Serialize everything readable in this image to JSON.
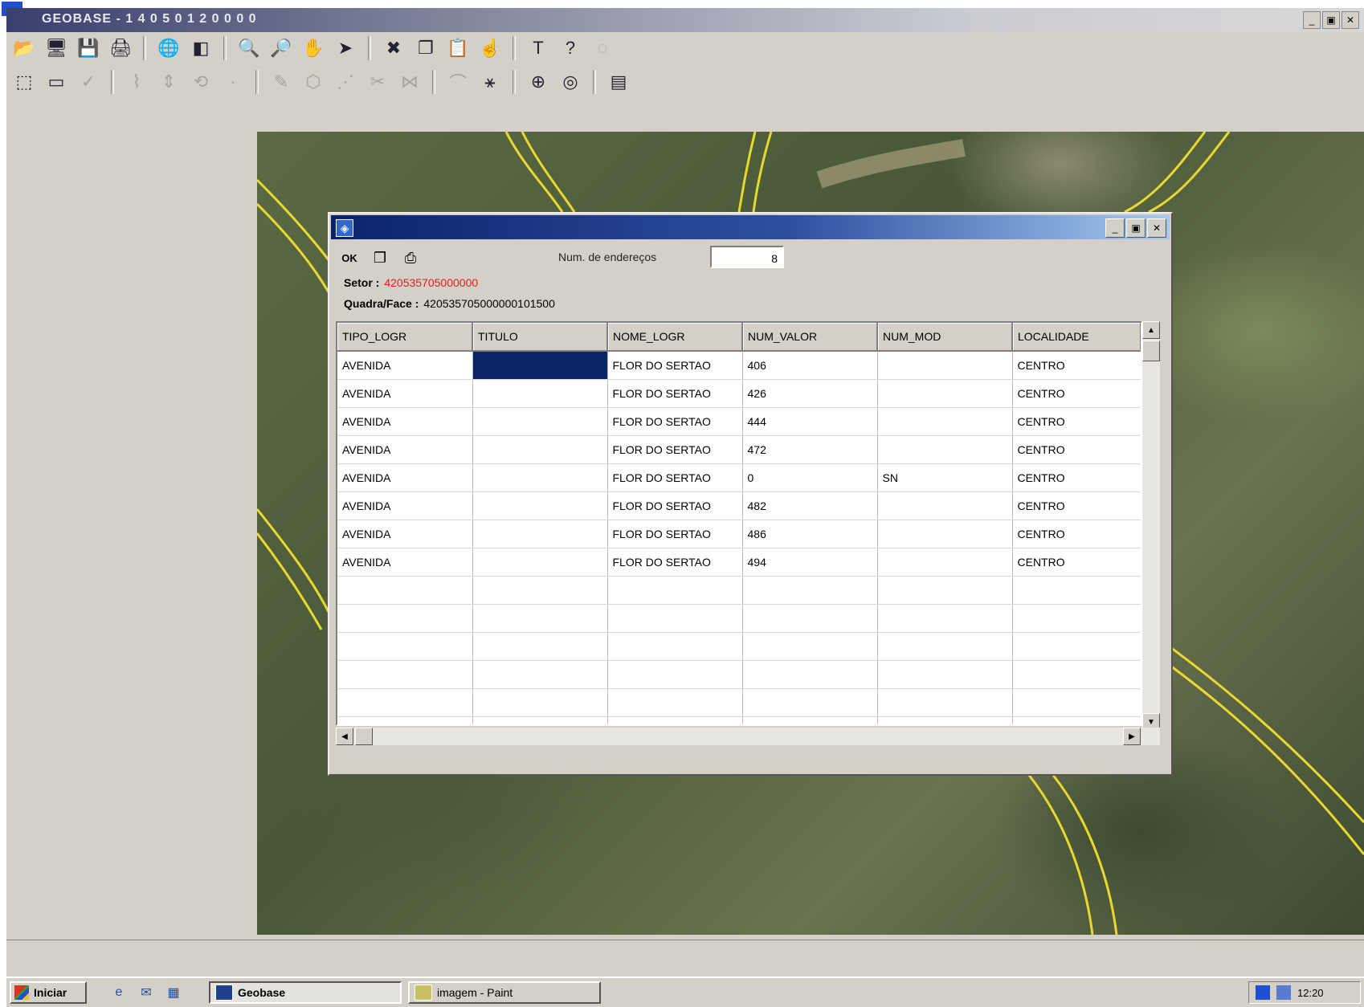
{
  "window": {
    "title": "GEOBASE - 1 4 0 5 0 1 2 0 0 0 0",
    "controls": [
      "_",
      "▣",
      "✕"
    ]
  },
  "toolbar": {
    "row1": [
      {
        "icon": "open-icon",
        "glyph": "📂",
        "enabled": true
      },
      {
        "icon": "monitor-icon",
        "glyph": "🖥",
        "enabled": true
      },
      {
        "icon": "save-icon",
        "glyph": "💾",
        "enabled": true
      },
      {
        "icon": "print-icon",
        "glyph": "🖨",
        "enabled": true
      },
      {
        "icon": "sep"
      },
      {
        "icon": "globe-icon",
        "glyph": "🌐",
        "enabled": true
      },
      {
        "icon": "layers-icon",
        "glyph": "◧",
        "enabled": true
      },
      {
        "icon": "sep"
      },
      {
        "icon": "zoom-in-icon",
        "glyph": "🔍",
        "enabled": true
      },
      {
        "icon": "zoom-out-icon",
        "glyph": "🔎",
        "enabled": true
      },
      {
        "icon": "pan-hand-icon",
        "glyph": "✋",
        "enabled": true
      },
      {
        "icon": "pointer-icon",
        "glyph": "➤",
        "enabled": true
      },
      {
        "icon": "sep"
      },
      {
        "icon": "delete-layer-icon",
        "glyph": "✖",
        "enabled": true
      },
      {
        "icon": "copy-icon",
        "glyph": "❐",
        "enabled": true
      },
      {
        "icon": "paste-icon",
        "glyph": "📋",
        "enabled": true
      },
      {
        "icon": "identify-icon",
        "glyph": "☝",
        "enabled": true
      },
      {
        "icon": "sep"
      },
      {
        "icon": "text-icon",
        "glyph": "T",
        "enabled": true
      },
      {
        "icon": "help-icon",
        "glyph": "?",
        "enabled": true
      },
      {
        "icon": "disabled-tool-icon",
        "glyph": "◌",
        "enabled": false
      }
    ],
    "row2": [
      {
        "icon": "select-rect-icon",
        "glyph": "⬚",
        "enabled": true
      },
      {
        "icon": "rectangle-icon",
        "glyph": "▭",
        "enabled": true
      },
      {
        "icon": "check-icon",
        "glyph": "✓",
        "enabled": false
      },
      {
        "icon": "sep"
      },
      {
        "icon": "edit-node-icon",
        "glyph": "⌇",
        "enabled": false
      },
      {
        "icon": "move-icon",
        "glyph": "⇕",
        "enabled": false
      },
      {
        "icon": "rotate-icon",
        "glyph": "⟲",
        "enabled": false
      },
      {
        "icon": "dot-icon",
        "glyph": "·",
        "enabled": false
      },
      {
        "icon": "sep"
      },
      {
        "icon": "pencil-icon",
        "glyph": "✎",
        "enabled": false
      },
      {
        "icon": "polygon-icon",
        "glyph": "⬡",
        "enabled": false
      },
      {
        "icon": "vertex-icon",
        "glyph": "⋰",
        "enabled": false
      },
      {
        "icon": "split-icon",
        "glyph": "✂",
        "enabled": false
      },
      {
        "icon": "merge-icon",
        "glyph": "⋈",
        "enabled": false
      },
      {
        "icon": "sep"
      },
      {
        "icon": "curve-icon",
        "glyph": "⌒",
        "enabled": false
      },
      {
        "icon": "network-icon",
        "glyph": "⚹",
        "enabled": true
      },
      {
        "icon": "sep"
      },
      {
        "icon": "gps-icon",
        "glyph": "⊕",
        "enabled": true
      },
      {
        "icon": "globe-2-icon",
        "glyph": "◎",
        "enabled": true
      },
      {
        "icon": "sep"
      },
      {
        "icon": "database-icon",
        "glyph": "▤",
        "enabled": true
      }
    ]
  },
  "dialog": {
    "toolbar": [
      {
        "icon": "ok-button",
        "glyph": "OK",
        "text": true
      },
      {
        "icon": "copy-records-icon",
        "glyph": "❐",
        "text": false
      },
      {
        "icon": "print-records-icon",
        "glyph": "⎙",
        "text": false
      }
    ],
    "num_enderecos_label": "Num. de endereços",
    "num_enderecos_value": "8",
    "setor_label": "Setor :",
    "setor_value": "420535705000000",
    "quadra_label": "Quadra/Face :",
    "quadra_value": "420535705000000101500",
    "columns": [
      "TIPO_LOGR",
      "TITULO",
      "NOME_LOGR",
      "NUM_VALOR",
      "NUM_MOD",
      "LOCALIDADE"
    ],
    "rows": [
      [
        "AVENIDA",
        "",
        "FLOR DO SERTAO",
        "406",
        "",
        "CENTRO"
      ],
      [
        "AVENIDA",
        "",
        "FLOR DO SERTAO",
        "426",
        "",
        "CENTRO"
      ],
      [
        "AVENIDA",
        "",
        "FLOR DO SERTAO",
        "444",
        "",
        "CENTRO"
      ],
      [
        "AVENIDA",
        "",
        "FLOR DO SERTAO",
        "472",
        "",
        "CENTRO"
      ],
      [
        "AVENIDA",
        "",
        "FLOR DO SERTAO",
        "0",
        "SN",
        "CENTRO"
      ],
      [
        "AVENIDA",
        "",
        "FLOR DO SERTAO",
        "482",
        "",
        "CENTRO"
      ],
      [
        "AVENIDA",
        "",
        "FLOR DO SERTAO",
        "486",
        "",
        "CENTRO"
      ],
      [
        "AVENIDA",
        "",
        "FLOR DO SERTAO",
        "494",
        "",
        "CENTRO"
      ]
    ],
    "empty_rows": 7,
    "selected_cell": {
      "row": 0,
      "col": 1
    }
  },
  "taskbar": {
    "start_label": "Iniciar",
    "quick_launch": [
      {
        "icon": "ie-icon",
        "glyph": "e"
      },
      {
        "icon": "outlook-icon",
        "glyph": "✉"
      },
      {
        "icon": "desktop-icon",
        "glyph": "▦"
      }
    ],
    "tasks": [
      {
        "label": "Geobase",
        "active": true,
        "icon": "geobase-task-icon"
      },
      {
        "label": "imagem - Paint",
        "active": false,
        "icon": "paint-task-icon"
      }
    ],
    "clock": "12:20"
  },
  "colors": {
    "dialog_title_start": "#0a246a",
    "selected_cell": "#0a246a",
    "setor_value": "#e02020",
    "road_line": "#e8d830"
  }
}
